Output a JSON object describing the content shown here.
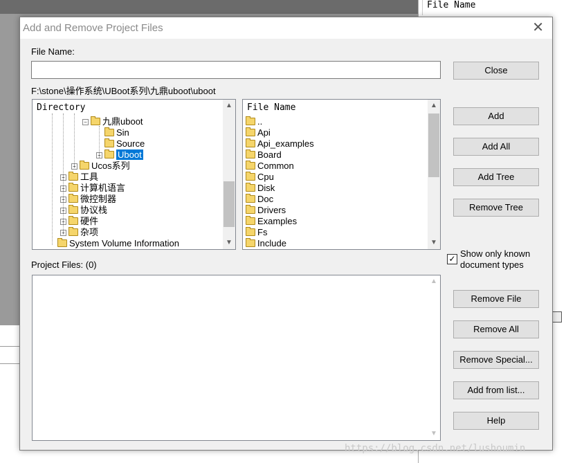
{
  "background": {
    "right_column_header": "File Name"
  },
  "dialog": {
    "title": "Add and Remove Project Files",
    "file_name_label": "File Name:",
    "file_name_value": "",
    "current_path": "F:\\stone\\操作系统\\UBoot系列\\九鼎uboot\\uboot",
    "directory_header": "Directory",
    "directory_tree": [
      {
        "label": "九鼎uboot",
        "expander": "minus"
      },
      {
        "label": "Sin",
        "expander": ""
      },
      {
        "label": "Source",
        "expander": ""
      },
      {
        "label": "Uboot",
        "expander": "plus",
        "selected": true
      },
      {
        "label": "Ucos系列",
        "expander": "plus"
      },
      {
        "label": "工具",
        "expander": "plus"
      },
      {
        "label": "计算机语言",
        "expander": "plus"
      },
      {
        "label": "微控制器",
        "expander": "plus"
      },
      {
        "label": "协议栈",
        "expander": "plus"
      },
      {
        "label": "硬件",
        "expander": "plus"
      },
      {
        "label": "杂项",
        "expander": "plus"
      },
      {
        "label": "System Volume Information",
        "expander": ""
      }
    ],
    "file_list_header": "File Name",
    "file_list": [
      "..",
      "Api",
      "Api_examples",
      "Board",
      "Common",
      "Cpu",
      "Disk",
      "Doc",
      "Drivers",
      "Examples",
      "Fs",
      "Include"
    ],
    "project_files_label": "Project Files: (0)",
    "project_files": [],
    "checkbox_label_line1": "Show only known",
    "checkbox_label_line2": "document types",
    "checkbox_checked": true,
    "buttons": {
      "close": "Close",
      "add": "Add",
      "add_all": "Add All",
      "add_tree": "Add Tree",
      "remove_tree": "Remove Tree",
      "remove_file": "Remove File",
      "remove_all": "Remove All",
      "remove_special": "Remove Special...",
      "add_from_list": "Add from list...",
      "help": "Help"
    }
  },
  "watermark": "https://blog.csdn.net/lushoumin"
}
